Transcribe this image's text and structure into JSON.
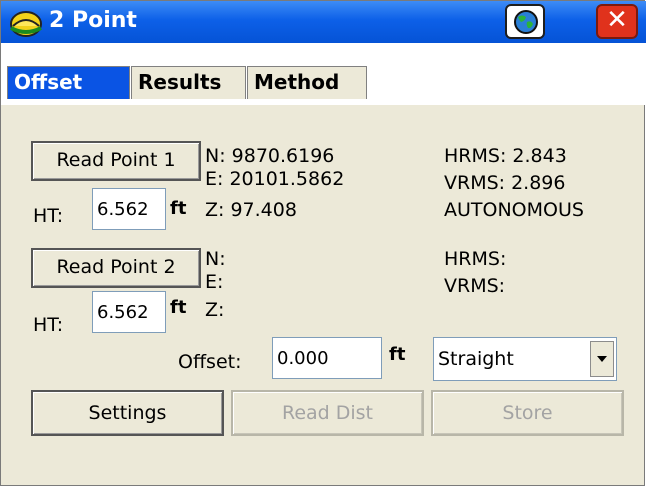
{
  "window": {
    "title": "2 Point"
  },
  "tabs": [
    {
      "label": "Offset",
      "active": true
    },
    {
      "label": "Results",
      "active": false
    },
    {
      "label": "Method",
      "active": false
    }
  ],
  "point1": {
    "button": "Read Point 1",
    "ht_label": "HT:",
    "ht_value": "6.562",
    "ht_unit": "ft",
    "n": "N:  9870.6196",
    "e": "E:  20101.5862",
    "z": "Z:  97.408",
    "hrms": "HRMS:  2.843",
    "vrms": "VRMS:  2.896",
    "status": "AUTONOMOUS"
  },
  "point2": {
    "button": "Read Point 2",
    "ht_label": "HT:",
    "ht_value": "6.562",
    "ht_unit": "ft",
    "n": "N:",
    "e": "E:",
    "z": "Z:",
    "hrms": "HRMS:",
    "vrms": "VRMS:"
  },
  "offset": {
    "label": "Offset:",
    "value": "0.000",
    "unit": "ft",
    "direction": "Straight"
  },
  "buttons": {
    "settings": "Settings",
    "read_dist": "Read Dist",
    "store": "Store"
  },
  "icons": {
    "app": "hardhat-icon",
    "globe": "globe-icon",
    "close": "close-icon"
  },
  "colors": {
    "titlebar": "#0553d6",
    "active_tab": "#0a54e4",
    "close": "#e0321c",
    "disabled_text": "#a3a3a3"
  }
}
